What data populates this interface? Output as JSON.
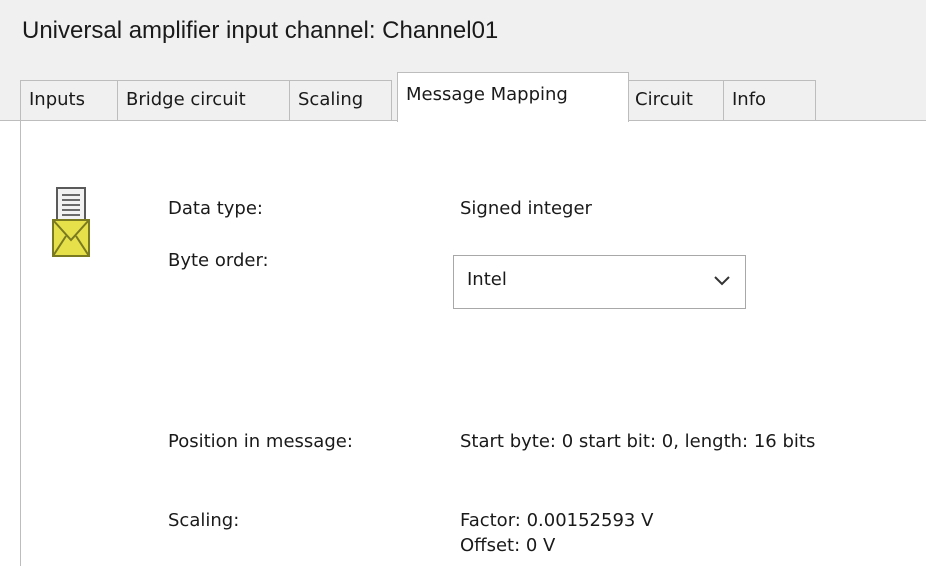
{
  "window": {
    "title": "Universal amplifier input channel: Channel01"
  },
  "tabs": [
    {
      "label": "Inputs",
      "active": false
    },
    {
      "label": "Bridge circuit",
      "active": false
    },
    {
      "label": "Scaling",
      "active": false
    },
    {
      "label": "Message Mapping",
      "active": true
    },
    {
      "label": "Circuit",
      "active": false
    },
    {
      "label": "Info",
      "active": false
    }
  ],
  "icon": "message-envelope-icon",
  "fields": {
    "data_type": {
      "label": "Data type:",
      "value": "Signed integer"
    },
    "byte_order": {
      "label": "Byte order:",
      "selected": "Intel"
    },
    "position": {
      "label": "Position in message:",
      "value": "Start byte: 0 start bit: 0, length: 16 bits"
    },
    "scaling": {
      "label": "Scaling:",
      "factor": "Factor: 0.00152593 V",
      "offset": "Offset: 0 V"
    }
  }
}
